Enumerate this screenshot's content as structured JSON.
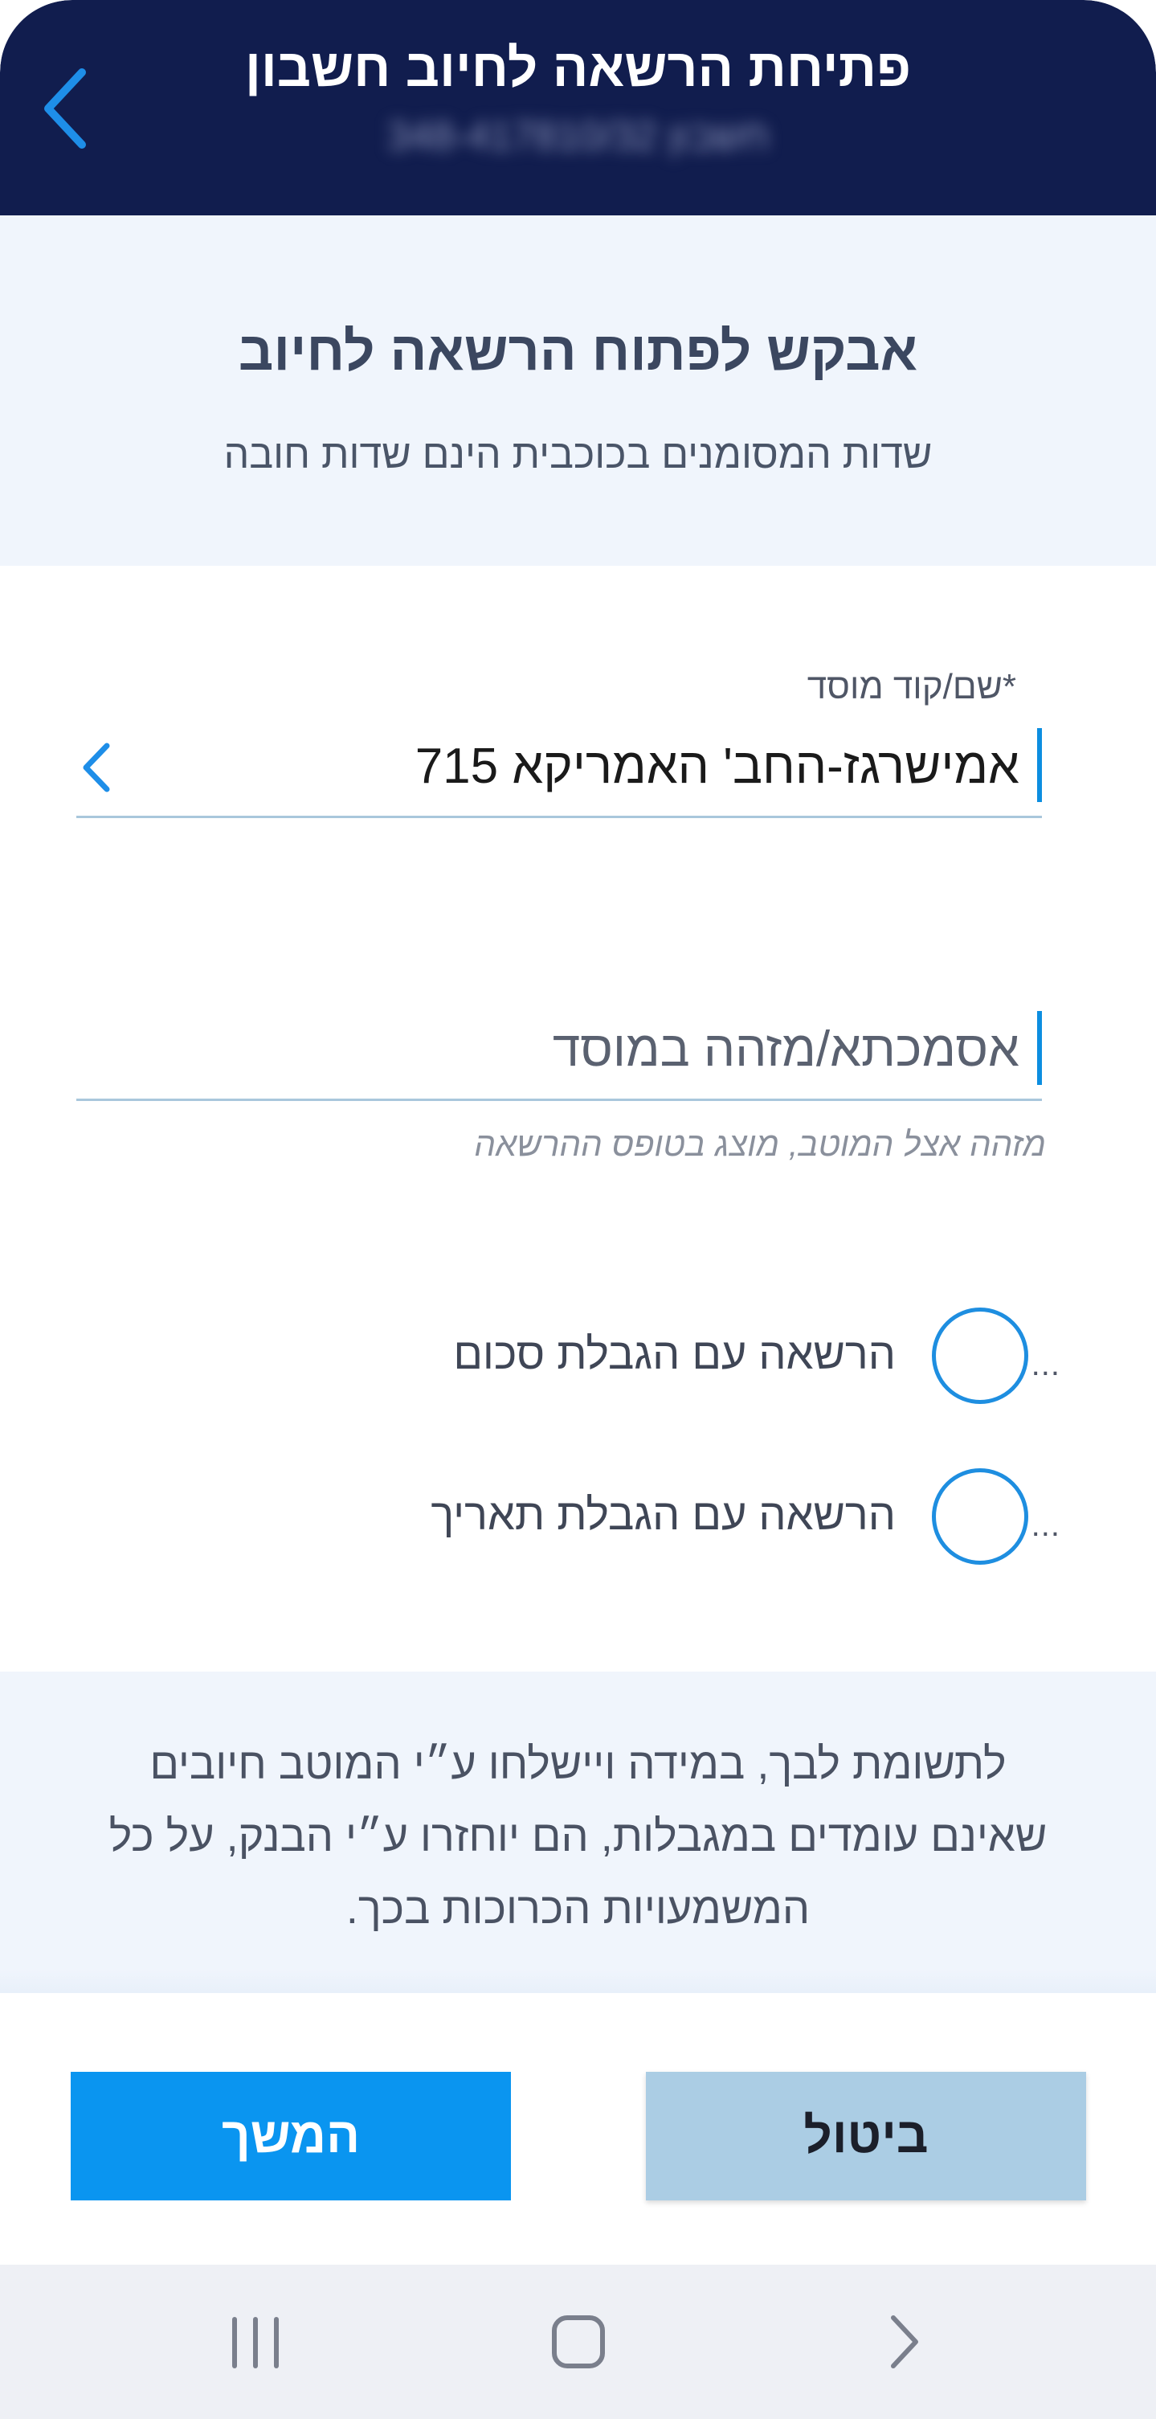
{
  "header": {
    "title": "פתיחת הרשאה לחיוב חשבון",
    "account_subtitle": "חשבון 348-417810/32"
  },
  "intro": {
    "title": "אבקש לפתוח הרשאה לחיוב",
    "required_note": "שדות המסומנים בכוכבית הינם שדות חובה"
  },
  "form": {
    "institution": {
      "label": "*שם/קוד מוסד",
      "value": "אמישרגז-החב' האמריקא 715"
    },
    "reference": {
      "placeholder": "אסמכתא/מזהה במוסד",
      "helper": "מזהה אצל המוטב, מוצג בטופס ההרשאה"
    },
    "options": [
      {
        "label": "הרשאה עם הגבלת סכום",
        "more": "...",
        "selected": false
      },
      {
        "label": "הרשאה עם הגבלת תאריך",
        "more": "...",
        "selected": false
      }
    ]
  },
  "notice": {
    "text": "לתשומת לבך, במידה ויישלחו ע״י המוטב חיובים שאינם עומדים במגבלות, הם יוחזרו ע״י הבנק, על כל המשמעויות הכרוכות בכך."
  },
  "buttons": {
    "continue_label": "המשך",
    "cancel_label": "ביטול"
  },
  "system_nav": {
    "icons": [
      "recent-apps-icon",
      "home-icon",
      "back-icon"
    ]
  },
  "colors": {
    "header_bg": "#111d4e",
    "accent": "#0a95f0",
    "cancel_bg": "#abcde4",
    "section_bg": "#f0f5fc"
  }
}
